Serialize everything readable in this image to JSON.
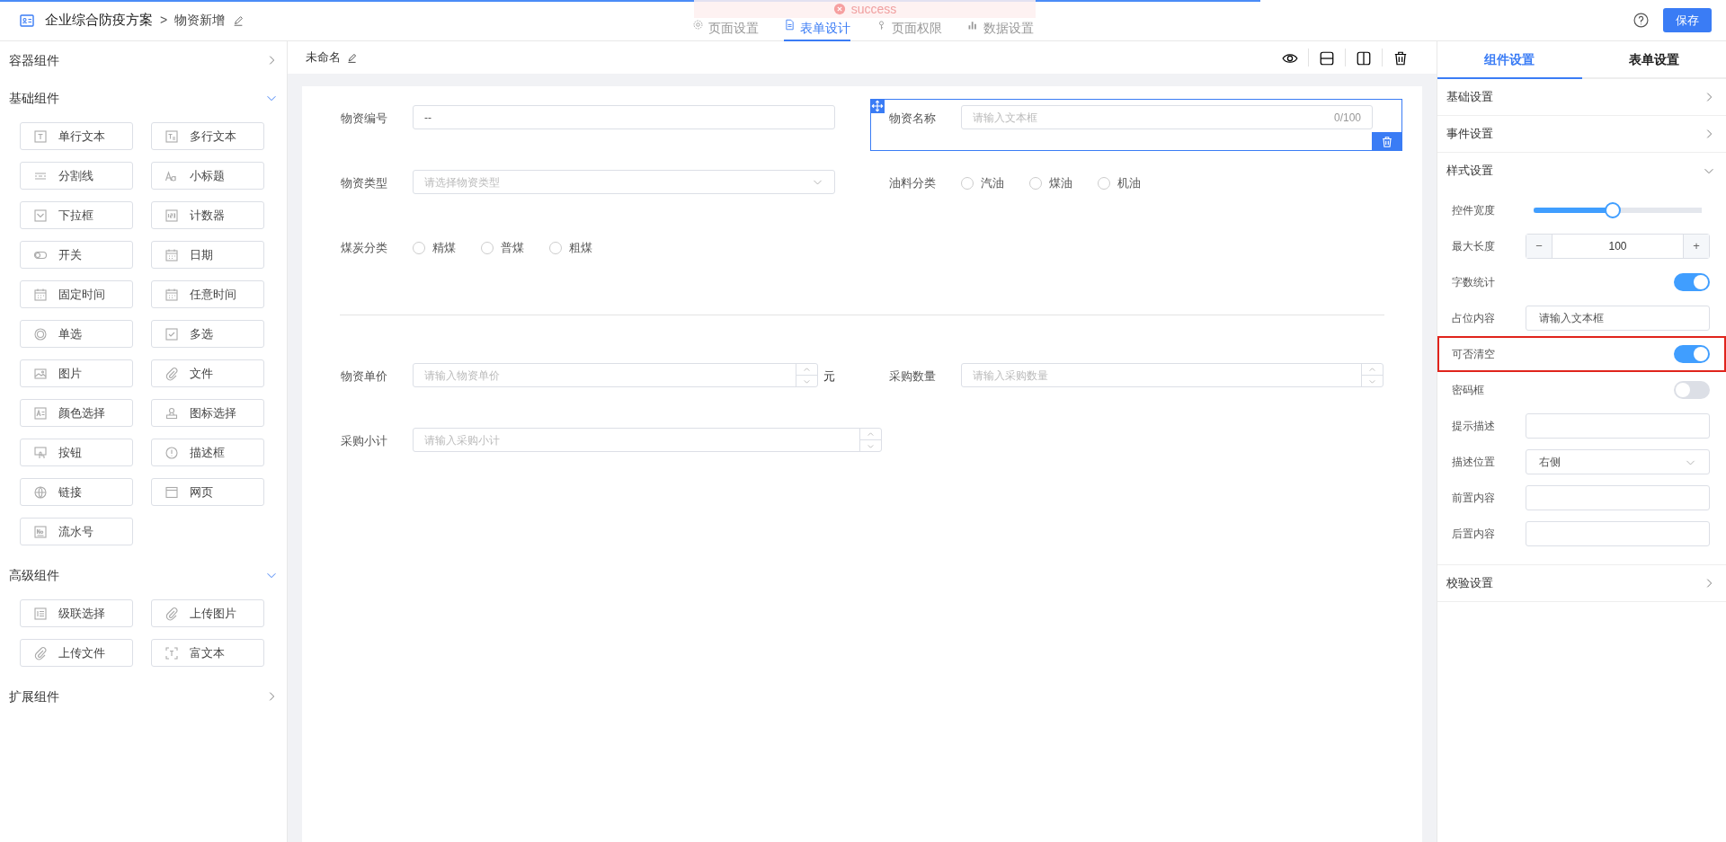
{
  "loading_bar": {
    "level": 0.73
  },
  "toast": {
    "text": "success"
  },
  "header": {
    "app_title": "企业综合防疫方案",
    "separator": ">",
    "page_title": "物资新增",
    "tabs": [
      {
        "label": "页面设置",
        "selected": false
      },
      {
        "label": "表单设计",
        "selected": true
      },
      {
        "label": "页面权限",
        "selected": false
      },
      {
        "label": "数据设置",
        "selected": false
      }
    ],
    "save_button": "保存"
  },
  "sidebar": {
    "sections": [
      {
        "title": "容器组件",
        "expanded": false
      },
      {
        "title": "基础组件",
        "expanded": true,
        "items": [
          "单行文本",
          "多行文本",
          "分割线",
          "小标题",
          "下拉框",
          "计数器",
          "开关",
          "日期",
          "固定时间",
          "任意时间",
          "单选",
          "多选",
          "图片",
          "文件",
          "颜色选择",
          "图标选择",
          "按钮",
          "描述框",
          "链接",
          "网页",
          "流水号"
        ]
      },
      {
        "title": "高级组件",
        "expanded": true,
        "items": [
          "级联选择",
          "上传图片",
          "上传文件",
          "富文本"
        ]
      },
      {
        "title": "扩展组件",
        "expanded": false
      }
    ]
  },
  "canvas": {
    "form_name": "未命名",
    "fields": [
      {
        "kind": "text",
        "label": "物资编号",
        "value": "--",
        "selected": false
      },
      {
        "kind": "text",
        "label": "物资名称",
        "placeholder": "请输入文本框",
        "counter": "0/100",
        "selected": true
      },
      {
        "kind": "select",
        "label": "物资类型",
        "placeholder": "请选择物资类型",
        "selected": false
      },
      {
        "kind": "radio",
        "label": "油料分类",
        "options": [
          {
            "label": "汽油",
            "checked": false
          },
          {
            "label": "煤油",
            "checked": false
          },
          {
            "label": "机油",
            "checked": false
          }
        ],
        "selected": false
      },
      {
        "kind": "radio",
        "label": "煤炭分类",
        "options": [
          {
            "label": "精煤",
            "checked": false
          },
          {
            "label": "普煤",
            "checked": false
          },
          {
            "label": "粗煤",
            "checked": false
          }
        ],
        "selected": false
      },
      {
        "kind": "divider",
        "selected": false
      },
      {
        "kind": "number",
        "label": "物资单价",
        "placeholder": "请输入物资单价",
        "unit": "元",
        "selected": false
      },
      {
        "kind": "number",
        "label": "采购数量",
        "placeholder": "请输入采购数量",
        "selected": false
      },
      {
        "kind": "number",
        "label": "采购小计",
        "placeholder": "请输入采购小计",
        "selected": false
      }
    ]
  },
  "settings": {
    "tabs": [
      {
        "label": "组件设置",
        "selected": true
      },
      {
        "label": "表单设置",
        "selected": false
      }
    ],
    "sections": [
      {
        "title": "基础设置",
        "expanded": false
      },
      {
        "title": "事件设置",
        "expanded": false
      },
      {
        "title": "样式设置",
        "expanded": true,
        "rows": [
          {
            "kind": "slider",
            "label": "控件宽度",
            "level": 0.47,
            "highlighted": false
          },
          {
            "kind": "stepper",
            "label": "最大长度",
            "value": "100",
            "minus": "−",
            "plus": "+",
            "highlighted": false
          },
          {
            "kind": "switch",
            "label": "字数统计",
            "on": true,
            "highlighted": false
          },
          {
            "kind": "input",
            "label": "占位内容",
            "value": "请输入文本框",
            "highlighted": false
          },
          {
            "kind": "switch",
            "label": "可否清空",
            "on": true,
            "highlighted": true
          },
          {
            "kind": "switch",
            "label": "密码框",
            "on": false,
            "highlighted": false
          },
          {
            "kind": "input",
            "label": "提示描述",
            "highlighted": false
          },
          {
            "kind": "select",
            "label": "描述位置",
            "value": "右侧",
            "highlighted": false
          },
          {
            "kind": "input",
            "label": "前置内容",
            "highlighted": false
          },
          {
            "kind": "input",
            "label": "后置内容",
            "highlighted": false
          }
        ]
      },
      {
        "title": "校验设置",
        "expanded": false
      }
    ]
  }
}
